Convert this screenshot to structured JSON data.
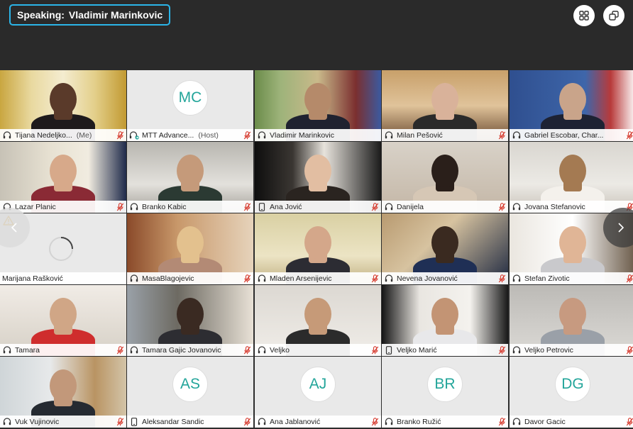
{
  "speaking": {
    "label": "Speaking:",
    "name": "Vladimir Marinkovic"
  },
  "colors": {
    "accent": "#2bb5e8",
    "avatar_text": "#23a59a",
    "mic_muted": "#d63a2e"
  },
  "icons": {
    "grid": "gallery-grid-icon",
    "popout": "popout-window-icon",
    "prev": "chevron-left-icon",
    "next": "chevron-right-icon"
  },
  "participants": [
    {
      "name": "Tijana Nedeljko...",
      "tag": "(Me)",
      "device": "headset",
      "muted": true,
      "video": true
    },
    {
      "name": "MTT Advance...",
      "tag": "(Host)",
      "device": "headset-share",
      "muted": true,
      "video": false,
      "initials": "MC"
    },
    {
      "name": "Vladimir Marinkovic",
      "tag": "",
      "device": "headset",
      "muted": false,
      "video": true,
      "active": true
    },
    {
      "name": "Milan Pešović",
      "tag": "",
      "device": "headset",
      "muted": true,
      "video": true
    },
    {
      "name": "Gabriel Escobar, Char...",
      "tag": "",
      "device": "headset",
      "muted": true,
      "video": true
    },
    {
      "name": "Lazar Planic",
      "tag": "",
      "device": "headset",
      "muted": true,
      "video": true
    },
    {
      "name": "Branko Kabic",
      "tag": "",
      "device": "headset",
      "muted": true,
      "video": true
    },
    {
      "name": "Ana Jović",
      "tag": "",
      "device": "phone",
      "muted": true,
      "video": true
    },
    {
      "name": "Danijela",
      "tag": "",
      "device": "headset",
      "muted": true,
      "video": true
    },
    {
      "name": "Jovana Stefanovic",
      "tag": "",
      "device": "headset",
      "muted": true,
      "video": true
    },
    {
      "name": "Marijana Rašković",
      "tag": "",
      "device": "none",
      "muted": false,
      "video": false,
      "loading": true
    },
    {
      "name": "MasaBlagojevic",
      "tag": "",
      "device": "headset",
      "muted": true,
      "video": true
    },
    {
      "name": "Mladen Arsenijevic",
      "tag": "",
      "device": "headset",
      "muted": true,
      "video": true
    },
    {
      "name": "Nevena Jovanović",
      "tag": "",
      "device": "headset",
      "muted": true,
      "video": true
    },
    {
      "name": "Stefan Zivotic",
      "tag": "",
      "device": "headset",
      "muted": true,
      "video": true
    },
    {
      "name": "Tamara",
      "tag": "",
      "device": "headset",
      "muted": true,
      "video": true
    },
    {
      "name": "Tamara Gajic Jovanovic",
      "tag": "",
      "device": "headset",
      "muted": true,
      "video": true
    },
    {
      "name": "Veljko",
      "tag": "",
      "device": "headset",
      "muted": true,
      "video": true
    },
    {
      "name": "Veljko Marić",
      "tag": "",
      "device": "phone",
      "muted": true,
      "video": true
    },
    {
      "name": "Veljko Petrovic",
      "tag": "",
      "device": "headset",
      "muted": true,
      "video": true
    },
    {
      "name": "Vuk Vujinovic",
      "tag": "",
      "device": "headset",
      "muted": true,
      "video": true
    },
    {
      "name": "Aleksandar Sandic",
      "tag": "",
      "device": "phone",
      "muted": true,
      "video": false,
      "initials": "AS"
    },
    {
      "name": "Ana Jablanović",
      "tag": "",
      "device": "headset",
      "muted": true,
      "video": false,
      "initials": "AJ"
    },
    {
      "name": "Branko Ružić",
      "tag": "",
      "device": "headset",
      "muted": true,
      "video": false,
      "initials": "BR"
    },
    {
      "name": "Davor Gacic",
      "tag": "",
      "device": "headset",
      "muted": true,
      "video": false,
      "initials": "DG"
    }
  ]
}
